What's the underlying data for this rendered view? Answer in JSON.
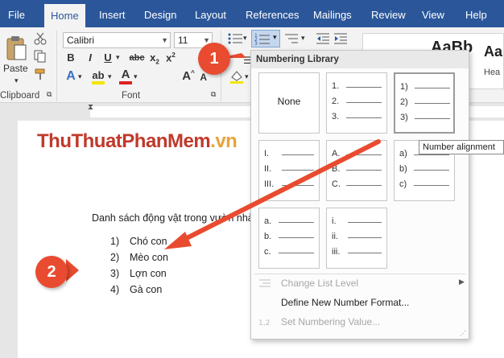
{
  "tabs": [
    "File",
    "Home",
    "Insert",
    "Design",
    "Layout",
    "References",
    "Mailings",
    "Review",
    "View",
    "Help"
  ],
  "active_tab": "Home",
  "ribbon": {
    "paste_label": "Paste",
    "clipboard_label": "Clipboard",
    "font_label": "Font",
    "font_name": "Calibri",
    "font_size": "11",
    "style_preview_1": "AaBb",
    "style_preview_2": "Aa",
    "style_caption": "Hea"
  },
  "document": {
    "logo_part1": "ThuThuatPhanMem",
    "logo_part2": ".vn",
    "title": "Danh sách động vật trong vườn nhà",
    "items": [
      {
        "num": "1)",
        "text": "Chó con"
      },
      {
        "num": "2)",
        "text": "Mèo con"
      },
      {
        "num": "3)",
        "text": "Lợn con"
      },
      {
        "num": "4)",
        "text": "Gà con"
      }
    ]
  },
  "menu": {
    "header": "Numbering Library",
    "none_label": "None",
    "formats": [
      [
        "1.",
        "2.",
        "3."
      ],
      [
        "1)",
        "2)",
        "3)"
      ],
      [
        "I.",
        "II.",
        "III."
      ],
      [
        "A.",
        "B.",
        "C."
      ],
      [
        "a)",
        "b)",
        "c)"
      ],
      [
        "a.",
        "b.",
        "c."
      ],
      [
        "i.",
        "ii.",
        "iii."
      ]
    ],
    "change_level": "Change List Level",
    "define_format": "Define New Number Format...",
    "set_value": "Set Numbering Value..."
  },
  "tooltip": "Number alignment",
  "callouts": {
    "one": "1",
    "two": "2"
  },
  "colors": {
    "accent": "#2b579a",
    "callout": "#e84b2f",
    "logo_red": "#c0392b",
    "logo_orange": "#e8a33c"
  }
}
